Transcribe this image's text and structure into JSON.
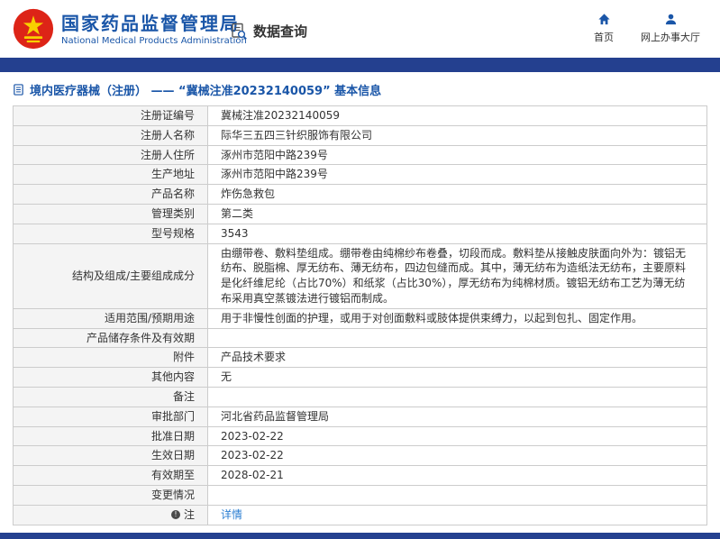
{
  "header": {
    "org_name_cn": "国家药品监督管理局",
    "org_name_en": "National Medical Products Administration",
    "nav_data_query": "数据查询",
    "link_home": "首页",
    "link_hall": "网上办事大厅"
  },
  "breadcrumb": {
    "text": "境内医疗器械（注册） ——  “冀械注准20232140059”  基本信息"
  },
  "table": {
    "rows": [
      {
        "label": "注册证编号",
        "value": "冀械注准20232140059"
      },
      {
        "label": "注册人名称",
        "value": "际华三五四三针织服饰有限公司"
      },
      {
        "label": "注册人住所",
        "value": "涿州市范阳中路239号"
      },
      {
        "label": "生产地址",
        "value": "涿州市范阳中路239号"
      },
      {
        "label": "产品名称",
        "value": "炸伤急救包"
      },
      {
        "label": "管理类别",
        "value": "第二类"
      },
      {
        "label": "型号规格",
        "value": "3543"
      },
      {
        "label": "结构及组成/主要组成成分",
        "value": "由绷带卷、敷料垫组成。绷带卷由纯棉纱布卷叠，切段而成。敷料垫从接触皮肤面向外为：镀铝无纺布、脱脂棉、厚无纺布、薄无纺布，四边包缝而成。其中，薄无纺布为造纸法无纺布，主要原料是化纤维尼纶（占比70%）和纸浆（占比30%），厚无纺布为纯棉材质。镀铝无纺布工艺为薄无纺布采用真空蒸镀法进行镀铝而制成。"
      },
      {
        "label": "适用范围/预期用途",
        "value": "用于非慢性创面的护理，或用于对创面敷料或肢体提供束缚力，以起到包扎、固定作用。"
      },
      {
        "label": "产品储存条件及有效期",
        "value": ""
      },
      {
        "label": "附件",
        "value": "产品技术要求"
      },
      {
        "label": "其他内容",
        "value": "无"
      },
      {
        "label": "备注",
        "value": ""
      },
      {
        "label": "审批部门",
        "value": "河北省药品监督管理局"
      },
      {
        "label": "批准日期",
        "value": "2023-02-22"
      },
      {
        "label": "生效日期",
        "value": "2023-02-22"
      },
      {
        "label": "有效期至",
        "value": "2028-02-21"
      },
      {
        "label": "变更情况",
        "value": ""
      },
      {
        "label": "注",
        "value": "详情",
        "link": true,
        "icon": "note-icon"
      }
    ]
  },
  "colors": {
    "accent_blue": "#1a56a8",
    "nav_bar_blue": "#24408f",
    "link_blue": "#2a7dd2",
    "label_bg": "#f4f4f4",
    "table_border": "#cccccc",
    "emblem_red": "#dd2417",
    "emblem_gold": "#f8d000"
  }
}
